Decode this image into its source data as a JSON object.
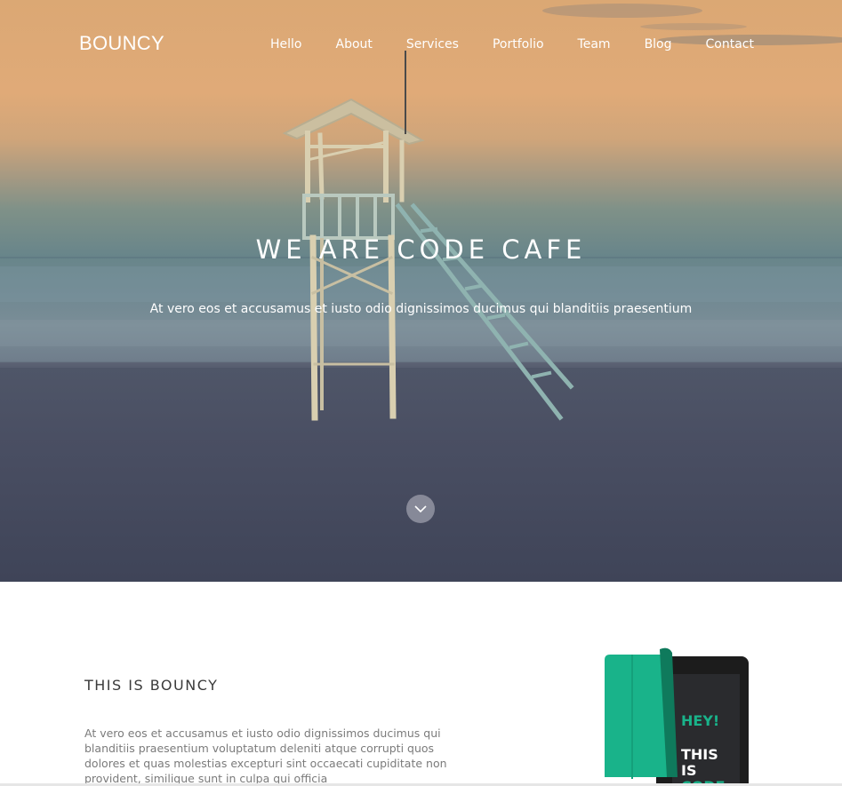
{
  "header": {
    "logo": "BOUNCY",
    "nav": [
      "Hello",
      "About",
      "Services",
      "Portfolio",
      "Team",
      "Blog",
      "Contact"
    ]
  },
  "hero": {
    "title": "WE ARE CODE CAFE",
    "subtitle": "At vero eos et accusamus et iusto odio dignissimos ducimus qui blanditiis praesentium",
    "scroll_icon": "chevron-down-icon"
  },
  "about": {
    "heading": "THIS IS BOUNCY",
    "text": "At vero eos et accusamus et iusto odio dignissimos ducimus qui blanditiis praesentium voluptatum deleniti atque corrupti quos dolores et quas molestias excepturi sint occaecati cupiditate non provident, similique sunt in culpa qui officia",
    "device_screen": [
      "HEY!",
      "THIS",
      "IS",
      "CODE"
    ]
  },
  "colors": {
    "accent_green": "#19b38a",
    "hero_sky": "#dba874",
    "hero_sand": "#454a5e"
  }
}
